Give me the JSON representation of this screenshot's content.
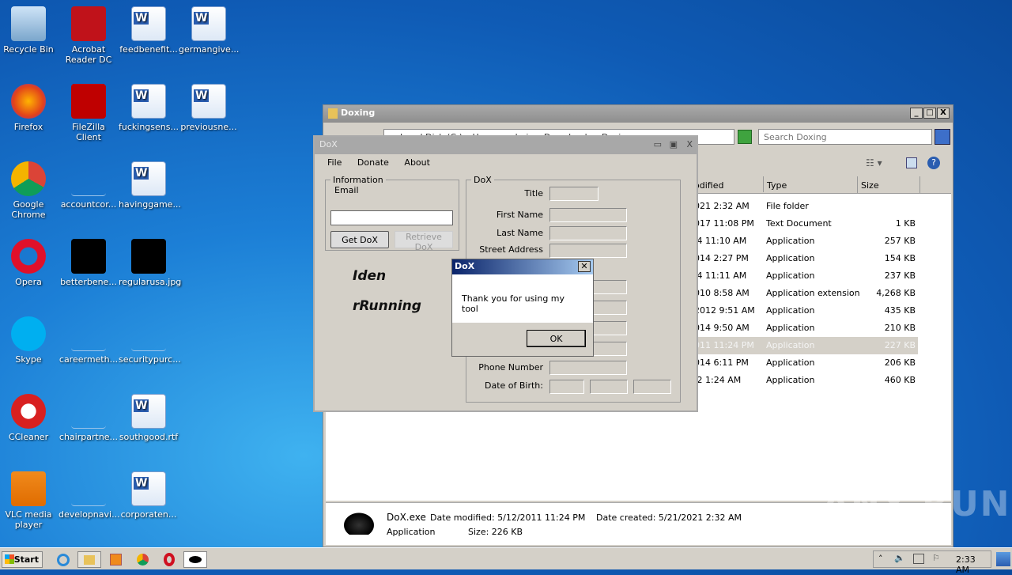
{
  "desktop": {
    "icons": [
      {
        "label": "Recycle Bin",
        "icon": "recycle-bin-icon",
        "col": 0,
        "row": 0
      },
      {
        "label": "Acrobat Reader DC",
        "icon": "acrobat-icon",
        "col": 1,
        "row": 0
      },
      {
        "label": "feedbenefit...",
        "icon": "word-doc-icon",
        "col": 2,
        "row": 0
      },
      {
        "label": "germangive...",
        "icon": "word-doc-icon",
        "col": 3,
        "row": 0
      },
      {
        "label": "Firefox",
        "icon": "firefox-icon",
        "col": 0,
        "row": 1
      },
      {
        "label": "FileZilla Client",
        "icon": "filezilla-icon",
        "col": 1,
        "row": 1
      },
      {
        "label": "fuckingsens...",
        "icon": "word-doc-icon",
        "col": 2,
        "row": 1
      },
      {
        "label": "previousne...",
        "icon": "word-doc-icon",
        "col": 3,
        "row": 1
      },
      {
        "label": "Google Chrome",
        "icon": "chrome-icon",
        "col": 0,
        "row": 2
      },
      {
        "label": "accountcor...",
        "icon": "blank-file-icon",
        "col": 1,
        "row": 2
      },
      {
        "label": "havinggame...",
        "icon": "word-doc-icon",
        "col": 2,
        "row": 2
      },
      {
        "label": "Opera",
        "icon": "opera-icon",
        "col": 0,
        "row": 3
      },
      {
        "label": "betterbene...",
        "icon": "image-thumbnail-icon",
        "col": 1,
        "row": 3
      },
      {
        "label": "regularusa.jpg",
        "icon": "image-thumbnail-icon",
        "col": 2,
        "row": 3
      },
      {
        "label": "Skype",
        "icon": "skype-icon",
        "col": 0,
        "row": 4
      },
      {
        "label": "careermeth...",
        "icon": "blank-file-icon",
        "col": 1,
        "row": 4
      },
      {
        "label": "securitypurc...",
        "icon": "blank-file-icon",
        "col": 2,
        "row": 4
      },
      {
        "label": "CCleaner",
        "icon": "ccleaner-icon",
        "col": 0,
        "row": 5
      },
      {
        "label": "chairpartne...",
        "icon": "blank-file-icon",
        "col": 1,
        "row": 5
      },
      {
        "label": "southgood.rtf",
        "icon": "word-doc-icon",
        "col": 2,
        "row": 5
      },
      {
        "label": "VLC media player",
        "icon": "vlc-icon",
        "col": 0,
        "row": 6
      },
      {
        "label": "developnavi...",
        "icon": "blank-file-icon",
        "col": 1,
        "row": 6
      },
      {
        "label": "corporaten...",
        "icon": "word-doc-icon",
        "col": 2,
        "row": 6
      }
    ]
  },
  "explorer": {
    "title": "Doxing",
    "address": "Local Disk (C:) ▸ Users ▸ admin ▸ Downloads ▸ Doxing",
    "search_placeholder": "Search Doxing",
    "columns": [
      "odified",
      "Type",
      "Size"
    ],
    "rows": [
      {
        "modified": "021 2:32 AM",
        "type": "File folder",
        "size": ""
      },
      {
        "modified": "017 11:08 PM",
        "type": "Text Document",
        "size": "1 KB"
      },
      {
        "modified": ".4 11:10 AM",
        "type": "Application",
        "size": "257 KB"
      },
      {
        "modified": "014 2:27 PM",
        "type": "Application",
        "size": "154 KB"
      },
      {
        "modified": ".4 11:11 AM",
        "type": "Application",
        "size": "237 KB"
      },
      {
        "modified": "010 8:58 AM",
        "type": "Application extension",
        "size": "4,268 KB"
      },
      {
        "modified": "2012 9:51 AM",
        "type": "Application",
        "size": "435 KB"
      },
      {
        "modified": "014 9:50 AM",
        "type": "Application",
        "size": "210 KB"
      },
      {
        "modified": "011 11:24 PM",
        "type": "Application",
        "size": "227 KB",
        "selected": true
      },
      {
        "modified": "014 6:11 PM",
        "type": "Application",
        "size": "206 KB"
      },
      {
        "modified": ".2 1:24 AM",
        "type": "Application",
        "size": "460 KB"
      }
    ],
    "details": {
      "name": "DoX.exe",
      "type": "Application",
      "modified_label": "Date modified: 5/12/2011 11:24 PM",
      "created_label": "Date created: 5/21/2021 2:32 AM",
      "size_label": "Size: 226 KB"
    }
  },
  "dox": {
    "title": "DoX",
    "menu": [
      "File",
      "Donate",
      "About"
    ],
    "info_group": "Information",
    "email_label": "Email",
    "email_value": "",
    "get_button": "Get DoX",
    "retrieve_button": "Retrieve DoX",
    "logo_line1": "Iden",
    "logo_line2": "rRunning",
    "dox_group": "DoX",
    "fields": [
      "Title",
      "First Name",
      "Last Name",
      "Street Address",
      "Phone Number",
      "Date of Birth:"
    ]
  },
  "msgbox": {
    "title": "DoX",
    "message": "Thank you for using my tool",
    "ok": "OK"
  },
  "taskbar": {
    "start": "Start",
    "clock": "2:33 AM"
  },
  "watermark": "ANY RUN"
}
